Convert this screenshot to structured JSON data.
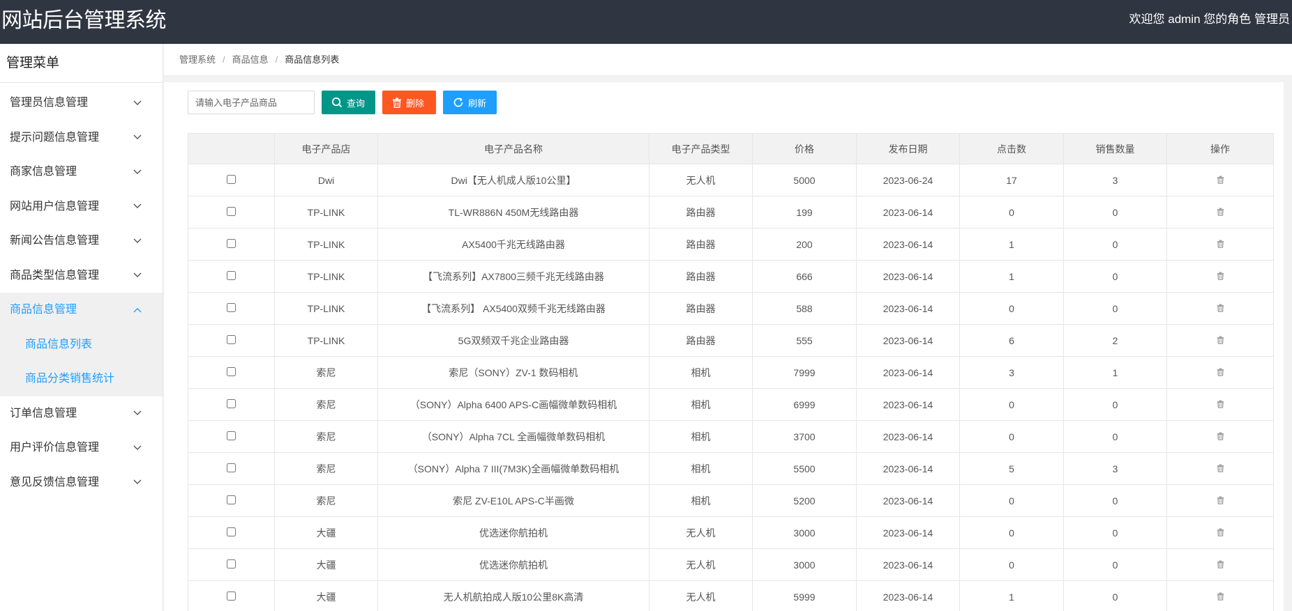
{
  "header": {
    "title": "网站后台管理系统",
    "welcome": "欢迎您 admin 您的角色 管理员"
  },
  "sidebar": {
    "title": "管理菜单",
    "items": [
      {
        "label": "管理员信息管理"
      },
      {
        "label": "提示问题信息管理"
      },
      {
        "label": "商家信息管理"
      },
      {
        "label": "网站用户信息管理"
      },
      {
        "label": "新闻公告信息管理"
      },
      {
        "label": "商品类型信息管理"
      },
      {
        "label": "商品信息管理"
      },
      {
        "label": "订单信息管理"
      },
      {
        "label": "用户评价信息管理"
      },
      {
        "label": "意见反馈信息管理"
      }
    ],
    "submenu": [
      {
        "label": "商品信息列表"
      },
      {
        "label": "商品分类销售统计"
      }
    ]
  },
  "breadcrumb": [
    "管理系统",
    "商品信息",
    "商品信息列表"
  ],
  "toolbar": {
    "search_placeholder": "请输入电子产品商品",
    "query_label": "查询",
    "delete_label": "删除",
    "refresh_label": "刷新"
  },
  "table": {
    "headers": [
      "",
      "电子产品店",
      "电子产品名称",
      "电子产品类型",
      "价格",
      "发布日期",
      "点击数",
      "销售数量",
      "操作"
    ],
    "rows": [
      {
        "store": "Dwi",
        "name": "Dwi【无人机成人版10公里】",
        "type": "无人机",
        "price": "5000",
        "date": "2023-06-24",
        "clicks": "17",
        "sales": "3"
      },
      {
        "store": "TP-LINK",
        "name": "TL-WR886N 450M无线路由器",
        "type": "路由器",
        "price": "199",
        "date": "2023-06-14",
        "clicks": "0",
        "sales": "0"
      },
      {
        "store": "TP-LINK",
        "name": "AX5400千兆无线路由器",
        "type": "路由器",
        "price": "200",
        "date": "2023-06-14",
        "clicks": "1",
        "sales": "0"
      },
      {
        "store": "TP-LINK",
        "name": "【飞流系列】AX7800三频千兆无线路由器",
        "type": "路由器",
        "price": "666",
        "date": "2023-06-14",
        "clicks": "1",
        "sales": "0"
      },
      {
        "store": "TP-LINK",
        "name": "【飞流系列】 AX5400双频千兆无线路由器",
        "type": "路由器",
        "price": "588",
        "date": "2023-06-14",
        "clicks": "0",
        "sales": "0"
      },
      {
        "store": "TP-LINK",
        "name": "5G双频双千兆企业路由器",
        "type": "路由器",
        "price": "555",
        "date": "2023-06-14",
        "clicks": "6",
        "sales": "2"
      },
      {
        "store": "索尼",
        "name": "索尼（SONY）ZV-1 数码相机",
        "type": "相机",
        "price": "7999",
        "date": "2023-06-14",
        "clicks": "3",
        "sales": "1"
      },
      {
        "store": "索尼",
        "name": "（SONY）Alpha 6400 APS-C画幅微单数码相机",
        "type": "相机",
        "price": "6999",
        "date": "2023-06-14",
        "clicks": "0",
        "sales": "0"
      },
      {
        "store": "索尼",
        "name": "（SONY）Alpha 7CL 全画幅微单数码相机",
        "type": "相机",
        "price": "3700",
        "date": "2023-06-14",
        "clicks": "0",
        "sales": "0"
      },
      {
        "store": "索尼",
        "name": "（SONY）Alpha 7 III(7M3K)全画幅微单数码相机",
        "type": "相机",
        "price": "5500",
        "date": "2023-06-14",
        "clicks": "5",
        "sales": "3"
      },
      {
        "store": "索尼",
        "name": "索尼 ZV-E10L APS-C半画微",
        "type": "相机",
        "price": "5200",
        "date": "2023-06-14",
        "clicks": "0",
        "sales": "0"
      },
      {
        "store": "大疆",
        "name": "优选迷你航拍机",
        "type": "无人机",
        "price": "3000",
        "date": "2023-06-14",
        "clicks": "0",
        "sales": "0"
      },
      {
        "store": "大疆",
        "name": "优选迷你航拍机",
        "type": "无人机",
        "price": "3000",
        "date": "2023-06-14",
        "clicks": "0",
        "sales": "0"
      },
      {
        "store": "大疆",
        "name": "无人机航拍成人版10公里8K高清",
        "type": "无人机",
        "price": "5999",
        "date": "2023-06-14",
        "clicks": "1",
        "sales": "0"
      }
    ]
  },
  "colors": {
    "topbar": "#2f3641",
    "query": "#009688",
    "delete": "#ff5722",
    "refresh": "#1e9fff",
    "active_menu": "#1e9fff"
  }
}
